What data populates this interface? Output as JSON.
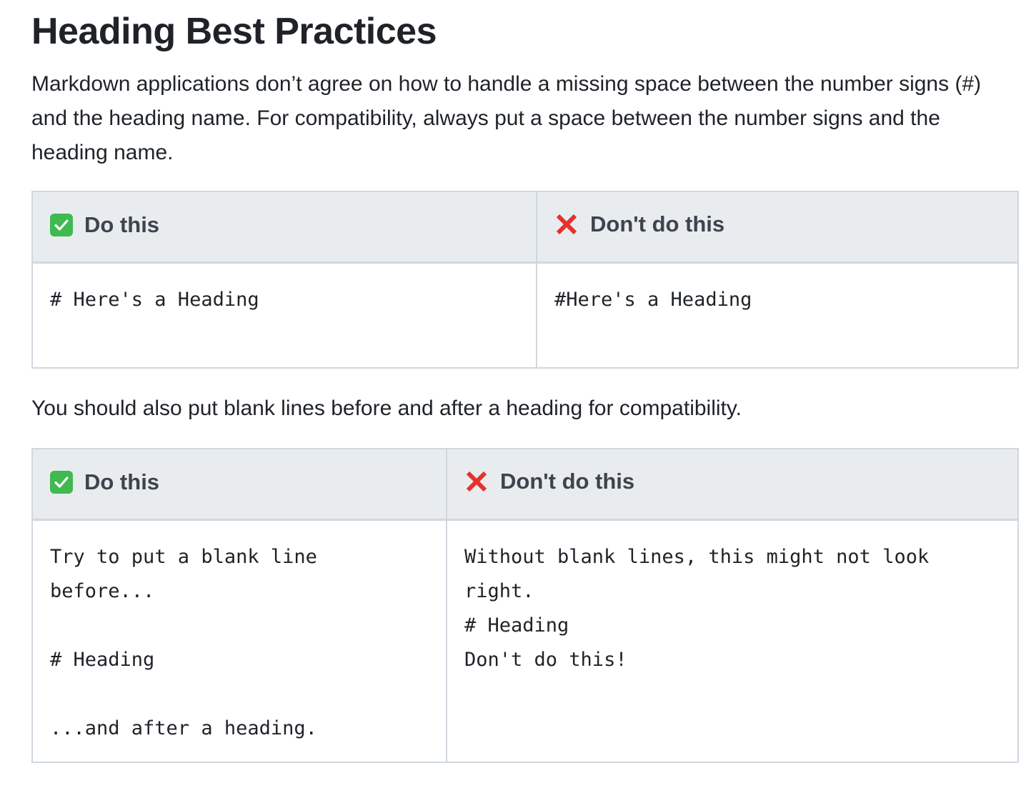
{
  "title": "Heading Best Practices",
  "intro": "Markdown applications don’t agree on how to handle a missing space between the number signs (#) and the heading name. For compatibility, always put a space between the number signs and the heading name.",
  "table1": {
    "do_header": "Do this",
    "dont_header": "Don't do this",
    "do_lines": [
      "# Here's a Heading"
    ],
    "dont_lines": [
      "#Here's a Heading"
    ]
  },
  "second_paragraph": "You should also put blank lines before and after a heading for compatibility.",
  "table2": {
    "do_header": "Do this",
    "dont_header": "Don't do this",
    "do_lines": [
      "Try to put a blank line",
      "before...",
      "",
      "# Heading",
      "",
      "...and after a heading."
    ],
    "dont_lines": [
      "Without blank lines, this might not look",
      "right.",
      "# Heading",
      "Don't do this!"
    ]
  },
  "icons": {
    "do": "check-mark-icon",
    "dont": "cross-mark-icon",
    "check_color": "#3fb950",
    "cross_color": "#e5322d"
  }
}
